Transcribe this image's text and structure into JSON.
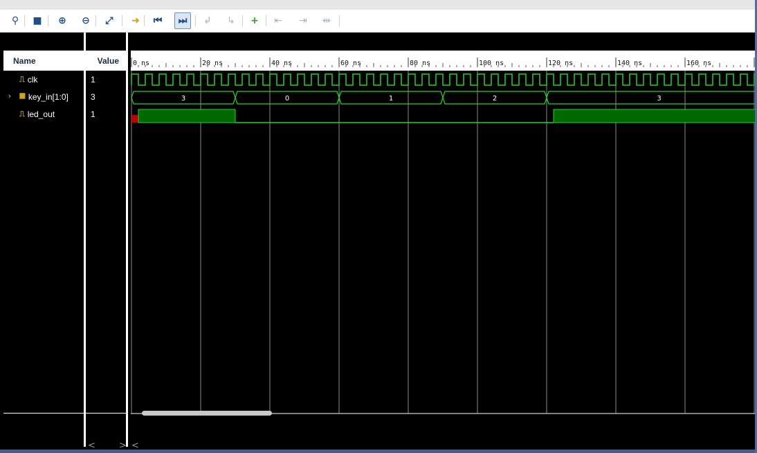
{
  "toolbar": {
    "buttons": [
      {
        "name": "search-icon",
        "glyph": "⚲"
      },
      {
        "name": "save-icon",
        "glyph": "■"
      },
      {
        "name": "zoom-in-icon",
        "glyph": "⊕"
      },
      {
        "name": "zoom-out-icon",
        "glyph": "⊖"
      },
      {
        "name": "zoom-fit-icon",
        "glyph": "⤢"
      },
      {
        "name": "go-to-cursor-icon",
        "glyph": "➜"
      },
      {
        "name": "go-to-time-zero-icon",
        "glyph": "⏮"
      },
      {
        "name": "go-to-last-time-icon",
        "glyph": "⏭"
      },
      {
        "name": "previous-transition-icon",
        "glyph": "↲"
      },
      {
        "name": "next-transition-icon",
        "glyph": "↳"
      },
      {
        "name": "add-marker-icon",
        "glyph": "+"
      },
      {
        "name": "previous-marker-icon",
        "glyph": "⇤"
      },
      {
        "name": "next-marker-icon",
        "glyph": "⇥"
      },
      {
        "name": "swap-cursors-icon",
        "glyph": "⇹"
      }
    ]
  },
  "columns": {
    "name_header": "Name",
    "value_header": "Value"
  },
  "signals": [
    {
      "name": "clk",
      "value": "1",
      "kind": "bit",
      "expandable": false
    },
    {
      "name": "key_in[1:0]",
      "value": "3",
      "kind": "bus",
      "expandable": true
    },
    {
      "name": "led_out",
      "value": "1",
      "kind": "bit",
      "expandable": false
    }
  ],
  "timeline": {
    "unit": "ns",
    "tick_labels": [
      "0 ns",
      "20 ns",
      "40 ns",
      "60 ns",
      "80 ns",
      "100 ns",
      "120 ns",
      "140 ns",
      "160 ns"
    ],
    "major_step": 20,
    "clock_period": 4,
    "key_in_segments": [
      {
        "start": 0,
        "end": 30,
        "label": "3"
      },
      {
        "start": 30,
        "end": 60,
        "label": "0"
      },
      {
        "start": 60,
        "end": 90,
        "label": "1"
      },
      {
        "start": 90,
        "end": 120,
        "label": "2"
      },
      {
        "start": 120,
        "end": 185,
        "label": "3"
      }
    ],
    "led_out_transitions": [
      {
        "t": 0,
        "v": "x"
      },
      {
        "t": 2,
        "v": 1
      },
      {
        "t": 30,
        "v": 0
      },
      {
        "t": 122,
        "v": 1
      }
    ]
  },
  "colors": {
    "wave_green": "#23d423",
    "fill_green": "#006a00",
    "unknown_red": "#c00000",
    "grid": "#8a8a8a"
  },
  "scroll": {
    "left_arrow": "<",
    "right_arrow": ">"
  }
}
